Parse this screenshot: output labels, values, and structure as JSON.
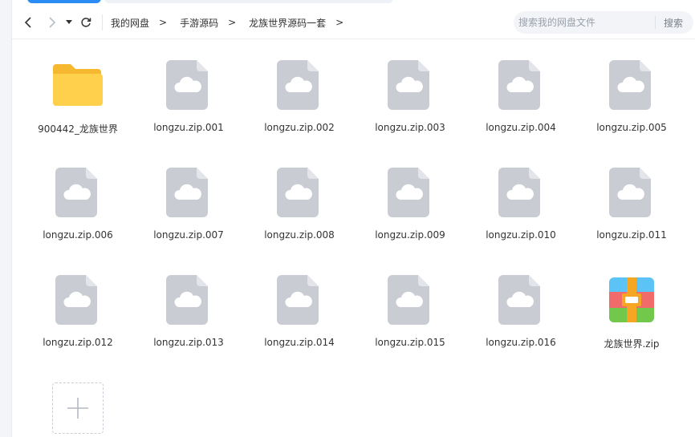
{
  "breadcrumb": {
    "items": [
      "我的网盘",
      "手游源码",
      "龙族世界源码一套"
    ],
    "separator": ">"
  },
  "search": {
    "placeholder": "搜索我的网盘文件",
    "button_label": "搜索"
  },
  "files": [
    {
      "name": "900442_龙族世界",
      "icon": "folder-icon"
    },
    {
      "name": "longzu.zip.001",
      "icon": "cloud-file-icon"
    },
    {
      "name": "longzu.zip.002",
      "icon": "cloud-file-icon"
    },
    {
      "name": "longzu.zip.003",
      "icon": "cloud-file-icon"
    },
    {
      "name": "longzu.zip.004",
      "icon": "cloud-file-icon"
    },
    {
      "name": "longzu.zip.005",
      "icon": "cloud-file-icon"
    },
    {
      "name": "longzu.zip.006",
      "icon": "cloud-file-icon"
    },
    {
      "name": "longzu.zip.007",
      "icon": "cloud-file-icon"
    },
    {
      "name": "longzu.zip.008",
      "icon": "cloud-file-icon"
    },
    {
      "name": "longzu.zip.009",
      "icon": "cloud-file-icon"
    },
    {
      "name": "longzu.zip.010",
      "icon": "cloud-file-icon"
    },
    {
      "name": "longzu.zip.011",
      "icon": "cloud-file-icon"
    },
    {
      "name": "longzu.zip.012",
      "icon": "cloud-file-icon"
    },
    {
      "name": "longzu.zip.013",
      "icon": "cloud-file-icon"
    },
    {
      "name": "longzu.zip.014",
      "icon": "cloud-file-icon"
    },
    {
      "name": "longzu.zip.015",
      "icon": "cloud-file-icon"
    },
    {
      "name": "longzu.zip.016",
      "icon": "cloud-file-icon"
    },
    {
      "name": "龙族世界.zip",
      "icon": "zip-archive-icon"
    }
  ],
  "colors": {
    "folder": "#ffd04b",
    "cloud_file": "#c9ccd3",
    "accent": "#2b8cf5"
  }
}
